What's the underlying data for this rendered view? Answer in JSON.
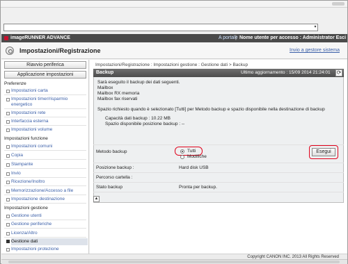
{
  "browser": {
    "address_value": "",
    "dropdown_glyph": "▾"
  },
  "topbar": {
    "product": "imageRUNNER ADVANCE",
    "portal_link": "A portale",
    "separator": "|",
    "user_info": "Nome utente per accesso : Administrator Esci"
  },
  "header": {
    "title": "Impostazioni/Registrazione",
    "send_to_system_link": "Invio a gestore sistema"
  },
  "sidebar": {
    "buttons": [
      "Riavvio periferica",
      "Applicazione impostazioni"
    ],
    "sections": [
      {
        "heading": "Preferenze",
        "items": [
          "Impostazioni carta",
          "Impostazioni timer/risparmio energetico",
          "Impostazioni rete",
          "Interfaccia esterna",
          "Impostazioni volume"
        ]
      },
      {
        "heading": "Impostazioni funzione",
        "items": [
          "Impostazioni comuni",
          "Copia",
          "Stampante",
          "Invio",
          "Ricezione/Inoltro",
          "Memorizzazione/Accesso a file"
        ]
      },
      {
        "heading": "Impostazione destinazione",
        "items": []
      },
      {
        "heading": "Impostazioni gestione",
        "items": [
          "Gestione utenti",
          "Gestione periferiche",
          "Licenza/Altro",
          "Gestione dati",
          "Impostazioni protezione"
        ]
      }
    ],
    "active_item": "Gestione dati"
  },
  "main": {
    "breadcrumb": "Impostazioni/Registrazione : Impostazioni gestione : Gestione dati > Backup",
    "panel": {
      "title": "Backup",
      "last_update": "Ultimo aggiornamento : 15/09 2014 21:24:01",
      "intro": "Sarà eseguito il backup dei dati seguenti.",
      "data_items": [
        "Mailbox",
        "Mailbox RX memoria",
        "Mailbox fax riservati"
      ],
      "space_note": "Spazio richiesto quando è selezionato [Tutti] per Metodo backup e spazio disponibile nella destinazione di backup",
      "capacity_label": "Capacità dati backup : 10.22 MB",
      "available_label": "Spazio disponibile posizione backup : --",
      "execute_button": "Esegui"
    },
    "settings": {
      "method_label": "Metodo backup",
      "method_options": [
        "Tutti",
        "Modifiche"
      ],
      "method_selected": "Tutti",
      "position_label": "Posizione backup :",
      "position_value": "Hard disk USB",
      "folder_label": "Percorso cartella :",
      "folder_value": "",
      "status_label": "Stato backup",
      "status_value": "Pronta per backup."
    },
    "up_icon_glyph": "▲"
  },
  "footer": {
    "copyright": "Copyright CANON INC. 2013 All Rights Reserved"
  },
  "colors": {
    "accent_link": "#3a5fa8",
    "topbar_bg": "#4a4a4a",
    "highlight_ring": "#e0001a",
    "logo_red": "#c8102e"
  }
}
